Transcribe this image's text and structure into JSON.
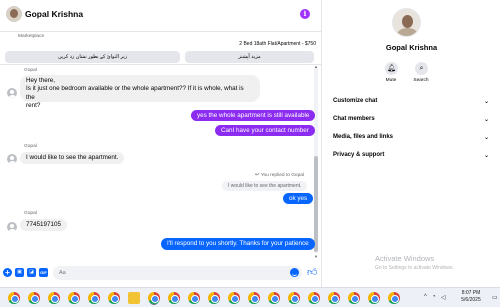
{
  "chat": {
    "contact_name": "Gopal Krishna",
    "marketplace_label": "Marketplace",
    "listing_title": "2 Bed 18ath Flat/Apartment - $750",
    "quick_replies": [
      "زیر التوائ کے بطور نشان زد کریں",
      "مزید آپشنز"
    ],
    "messages": [
      {
        "sender": "Gopal",
        "type": "incoming",
        "text_lines": [
          "Hey there,",
          "Is it just one bedroom available or the whole apartment?? If it is whole, what is the",
          "rent?"
        ]
      },
      {
        "type": "outgoing",
        "text": "yes the whole apartment is still available"
      },
      {
        "type": "outgoing",
        "text": "CanI have your contact number"
      },
      {
        "sender": "Gopal",
        "type": "incoming",
        "text": "I would like to see the apartment."
      },
      {
        "type": "reply-note",
        "note": "You replied to Gopal",
        "quoted": "I would like to see the apartment."
      },
      {
        "type": "outgoing",
        "text": "ok yes"
      },
      {
        "sender": "Gopal",
        "type": "incoming",
        "text": "7745197105"
      },
      {
        "type": "outgoing",
        "text": "I'll respond to you shortly. Thanks for your patience"
      }
    ],
    "composer": {
      "placeholder": "Aa"
    }
  },
  "info_panel": {
    "name": "Gopal Krishna",
    "actions": [
      {
        "label": "Mute",
        "icon": "bell-icon"
      },
      {
        "label": "Search",
        "icon": "search-icon"
      }
    ],
    "sections": [
      "Customize chat",
      "Chat members",
      "Media, files and links",
      "Privacy & support"
    ],
    "watermark_title": "Activate Windows",
    "watermark_subtitle": "Go to Settings to activate Windows."
  },
  "taskbar": {
    "time": "8:07 PM",
    "date": "5/6/2025"
  },
  "colors": {
    "purple_bubble": "#8c2cf0",
    "blue_bubble": "#0866ff",
    "incoming_bubble": "#f0f0f0"
  }
}
